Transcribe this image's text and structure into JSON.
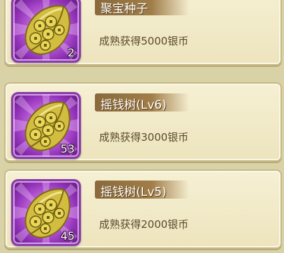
{
  "items": [
    {
      "name": "聚宝种子",
      "desc": "成熟获得5000银币",
      "count": "2"
    },
    {
      "name": "摇钱树(Lv6)",
      "desc": "成熟获得3000银币",
      "count": "53"
    },
    {
      "name": "摇钱树(Lv5)",
      "desc": "成熟获得2000银币",
      "count": "45"
    }
  ],
  "colors": {
    "frame_purple": "#8e31b5",
    "seed_gold": "#d8c24a",
    "name_tag": "#a07d48"
  }
}
